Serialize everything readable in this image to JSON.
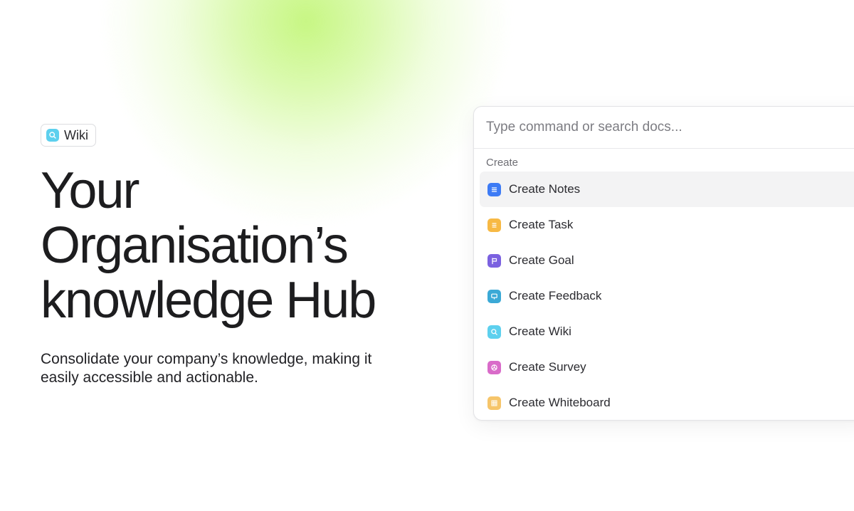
{
  "badge": {
    "label": "Wiki",
    "icon": "search-icon",
    "color": "#5DD0EE"
  },
  "hero": {
    "title_lines": [
      "Your",
      "Organisation’s",
      "knowledge Hub"
    ],
    "subtitle_lines": [
      "Consolidate your company’s knowledge, making it",
      "easily accessible and actionable."
    ]
  },
  "command_palette": {
    "search_placeholder": "Type command or search docs...",
    "search_value": "",
    "section_label": "Create",
    "items": [
      {
        "label": "Create Notes",
        "icon": "notes-icon",
        "color": "#3D7BF5",
        "highlighted": true
      },
      {
        "label": "Create Task",
        "icon": "task-icon",
        "color": "#F7B944",
        "highlighted": false
      },
      {
        "label": "Create Goal",
        "icon": "flag-icon",
        "color": "#7B61E0",
        "highlighted": false
      },
      {
        "label": "Create Feedback",
        "icon": "feedback-icon",
        "color": "#3BA9D6",
        "highlighted": false
      },
      {
        "label": "Create Wiki",
        "icon": "search-icon",
        "color": "#5DD0EE",
        "highlighted": false
      },
      {
        "label": "Create Survey",
        "icon": "survey-icon",
        "color": "#D96BC9",
        "highlighted": false
      },
      {
        "label": "Create Whiteboard",
        "icon": "whiteboard-icon",
        "color": "#F6C56A",
        "highlighted": false
      }
    ]
  }
}
